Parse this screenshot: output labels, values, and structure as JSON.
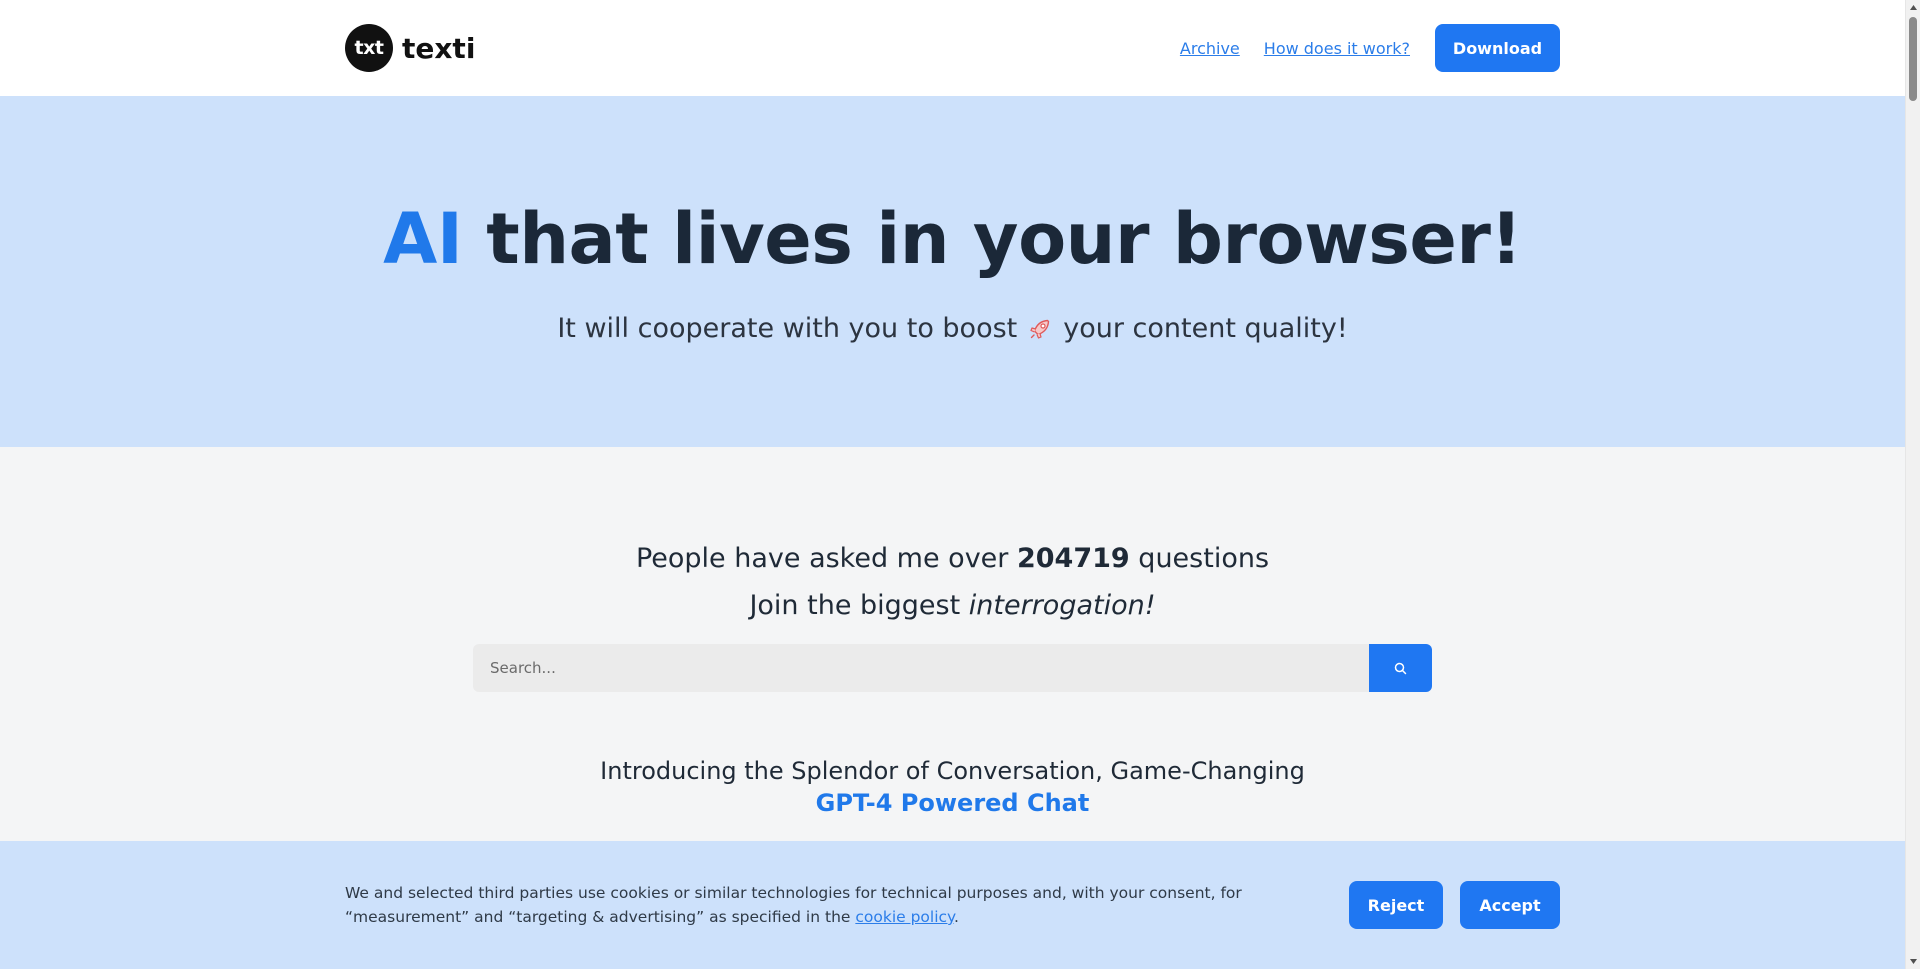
{
  "header": {
    "logo_mark": "txt",
    "logo_text": "texti",
    "nav": {
      "archive": "Archive",
      "how_it_works": "How does it work?"
    },
    "download_label": "Download"
  },
  "hero": {
    "title_accent": "AI",
    "title_rest": " that lives in your browser!",
    "subtitle_before": "It will cooperate with you to boost",
    "subtitle_after": "your content quality!",
    "emoji_icon": "rocket-icon"
  },
  "stats": {
    "prefix": "People have asked me over ",
    "count": "204719",
    "suffix": " questions",
    "join_prefix": "Join the biggest ",
    "join_em": "interrogation!"
  },
  "search": {
    "placeholder": "Search...",
    "icon": "search-icon"
  },
  "intro": {
    "line1": "Introducing the Splendor of Conversation, Game-Changing",
    "line2": "GPT-4 Powered Chat"
  },
  "cookie": {
    "text_before": "We and selected third parties use cookies or similar technologies for technical purposes and, with your consent, for “measurement” and “targeting & advertising” as specified in the ",
    "link_text": "cookie policy",
    "text_after": ".",
    "reject_label": "Reject",
    "accept_label": "Accept"
  },
  "colors": {
    "accent": "#1f77f2",
    "hero_bg": "#cde1fb",
    "page_bg": "#f4f5f6",
    "text_dark": "#1b2838"
  }
}
